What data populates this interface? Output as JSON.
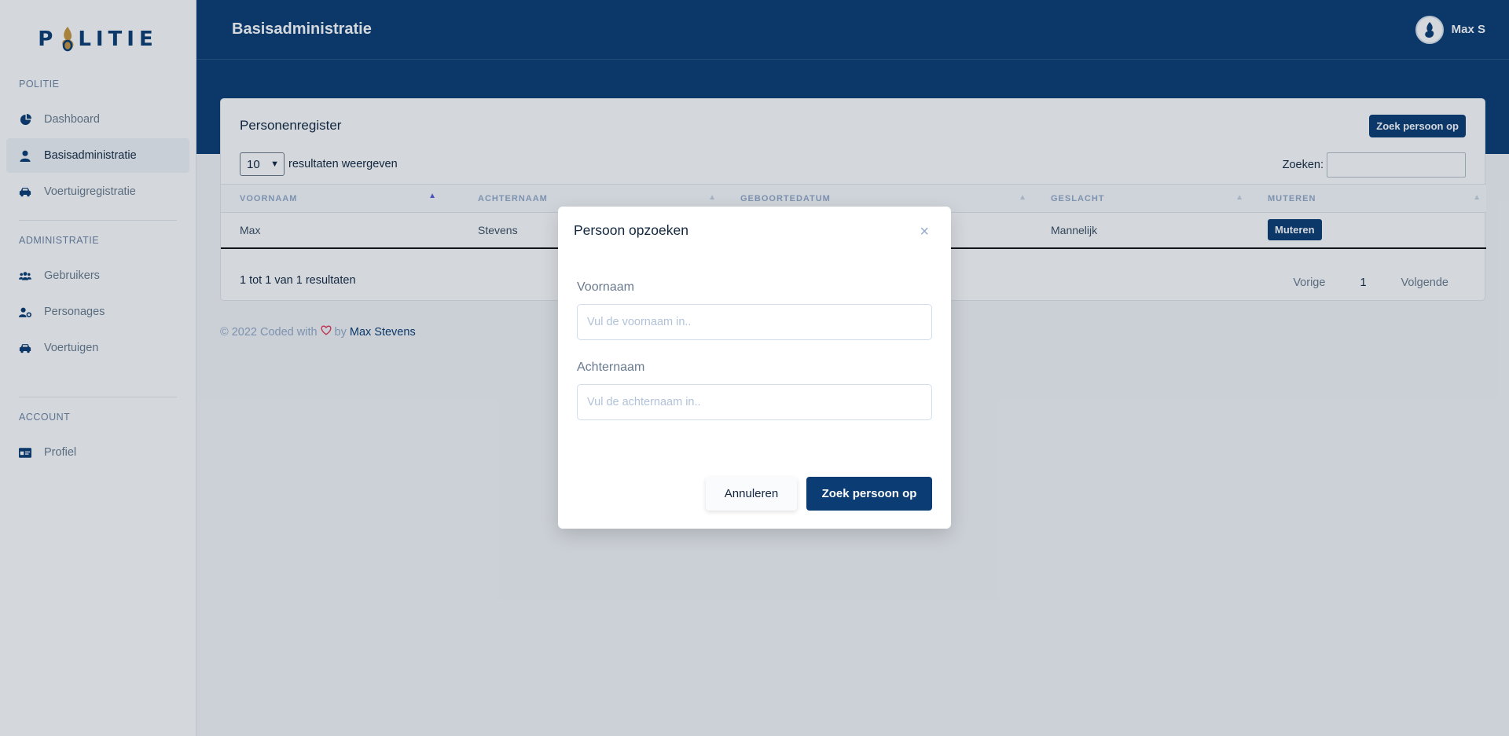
{
  "sidebar": {
    "logo_left": "P",
    "logo_right": "LITIE",
    "section_politie": "POLITIE",
    "item_dashboard": "Dashboard",
    "item_basisadministratie": "Basisadministratie",
    "item_voertuigregistratie": "Voertuigregistratie",
    "section_administratie": "ADMINISTRATIE",
    "item_gebruikers": "Gebruikers",
    "item_personages": "Personages",
    "item_voertuigen": "Voertuigen",
    "section_account": "ACCOUNT",
    "item_profiel": "Profiel"
  },
  "header": {
    "title": "Basisadministratie",
    "user_name": "Max S"
  },
  "card": {
    "title": "Personenregister",
    "search_person_button": "Zoek persoon op",
    "page_length": "10",
    "page_length_suffix": "resultaten weergeven",
    "search_label": "Zoeken:",
    "columns": [
      "VOORNAAM",
      "ACHTERNAAM",
      "GEBOORTEDATUM",
      "GESLACHT",
      "MUTEREN"
    ],
    "rows": [
      {
        "voornaam": "Max",
        "achternaam": "Stevens",
        "geboortedatum": "",
        "geslacht": "Mannelijk",
        "action": "Muteren"
      }
    ],
    "info": "1 tot 1 van 1 resultaten",
    "pager_prev": "Vorige",
    "pager_current": "1",
    "pager_next": "Volgende"
  },
  "footer": {
    "text_before": "© 2022 Coded with",
    "text_by": "by",
    "author": "Max Stevens"
  },
  "modal": {
    "title": "Persoon opzoeken",
    "close": "×",
    "firstname_label": "Voornaam",
    "firstname_placeholder": "Vul de voornaam in..",
    "lastname_label": "Achternaam",
    "lastname_placeholder": "Vul de achternaam in..",
    "cancel_button": "Annuleren",
    "submit_button": "Zoek persoon op"
  },
  "colors": {
    "brand": "#0b3c73",
    "logo_gold": "#c8963e"
  }
}
